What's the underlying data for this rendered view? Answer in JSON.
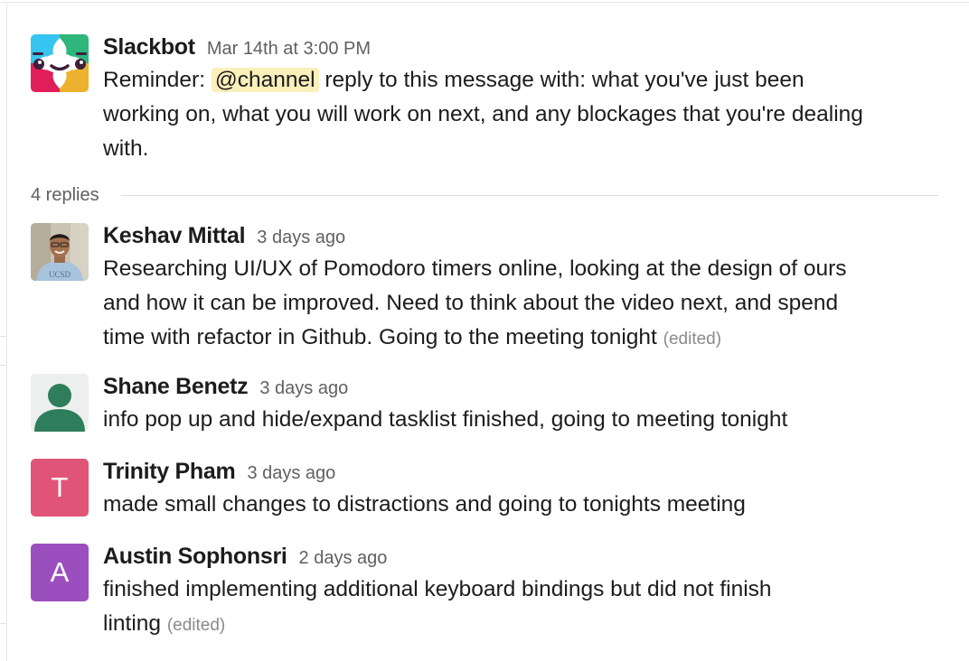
{
  "thread": {
    "parent": {
      "sender": "Slackbot",
      "timestamp": "Mar 14th at 3:00 PM",
      "text_before": "Reminder: ",
      "mention": "@channel",
      "text_line1_after": " reply to this message with: what you've just been",
      "text_line2": "working on, what you will work on next, and any blockages that you're dealing",
      "text_line3": "with."
    },
    "replies_label": "4 replies",
    "replies": [
      {
        "sender": "Keshav Mittal",
        "timestamp": "3 days ago",
        "lines": [
          "Researching UI/UX of Pomodoro timers online, looking at the design of ours",
          "and how it can be improved. Need to think about the video next, and spend",
          "time with refactor in Github. Going to the meeting tonight"
        ],
        "edited": "(edited)"
      },
      {
        "sender": "Shane Benetz",
        "timestamp": "3 days ago",
        "lines": [
          "info pop up and hide/expand tasklist finished, going to meeting tonight"
        ],
        "avatar_color": "#2e7d5b"
      },
      {
        "sender": "Trinity Pham",
        "timestamp": "3 days ago",
        "avatar_letter": "T",
        "avatar_color": "#e05577",
        "lines": [
          "made small changes to distractions and going to tonights meeting"
        ]
      },
      {
        "sender": "Austin Sophonsri",
        "timestamp": "2 days ago",
        "avatar_letter": "A",
        "avatar_color": "#9b4fbf",
        "lines": [
          "finished implementing additional keyboard bindings but did not finish",
          "linting"
        ],
        "edited": "(edited)"
      }
    ]
  }
}
